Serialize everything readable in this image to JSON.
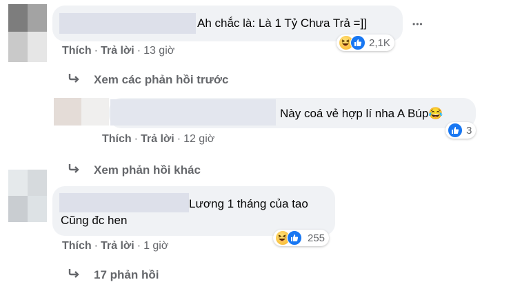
{
  "comments": [
    {
      "text": "Ah chắc là: Là 1 Tỷ Chưa Trả =]]",
      "actions": {
        "like": "Thích",
        "reply": "Trả lời",
        "time": "13 giờ"
      },
      "reactions": {
        "icons": [
          "haha-icon",
          "like-icon"
        ],
        "count": "2,1K"
      },
      "more": "•••"
    },
    {
      "text": "Này coá vẻ hợp lí nha A Búp😂",
      "actions": {
        "like": "Thích",
        "reply": "Trả lời",
        "time": "12 giờ"
      },
      "reactions": {
        "icons": [
          "like-icon"
        ],
        "count": "3"
      }
    },
    {
      "text_lines": [
        "Lương 1 tháng của tao",
        "Cũng đc hen"
      ],
      "actions": {
        "like": "Thích",
        "reply": "Trả lời",
        "time": "1 giờ"
      },
      "reactions": {
        "icons": [
          "haha-icon",
          "like-icon"
        ],
        "count": "255"
      }
    }
  ],
  "reply_links": {
    "previous": "Xem các phản hồi trước",
    "more": "Xem phản hồi khác",
    "count": "17 phản hồi"
  },
  "separator": "·",
  "colors": {
    "bubble": "#f0f2f5",
    "meta": "#65676b",
    "like_blue": "#1877f2",
    "haha_yellow": "#f7b125"
  }
}
